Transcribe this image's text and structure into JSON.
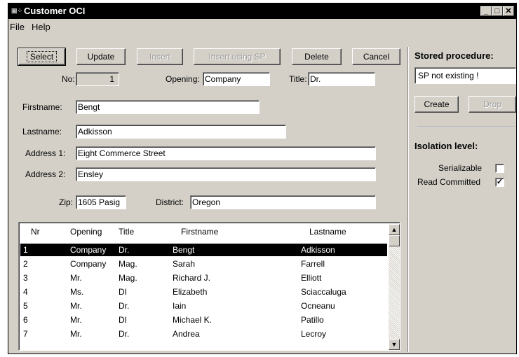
{
  "window": {
    "title": "Customer OCI",
    "icon": "window-app-icon"
  },
  "menu": [
    {
      "label": "File"
    },
    {
      "label": "Help"
    }
  ],
  "toolbar": {
    "select": "Select",
    "update": "Update",
    "insert": "Insert",
    "insert_sp": "Insert using SP",
    "delete": "Delete",
    "cancel": "Cancel"
  },
  "form": {
    "no_label": "No:",
    "no_value": "1",
    "opening_label": "Opening:",
    "opening_value": "Company",
    "title_label": "Title:",
    "title_value": "Dr.",
    "firstname_label": "Firstname:",
    "firstname_value": "Bengt",
    "lastname_label": "Lastname:",
    "lastname_value": "Adkisson",
    "address1_label": "Address 1:",
    "address1_value": "Eight Commerce Street",
    "address2_label": "Address 2:",
    "address2_value": "Ensley",
    "zip_label": "Zip:",
    "zip_value": "1605 Pasig",
    "district_label": "District:",
    "district_value": "Oregon"
  },
  "table": {
    "headers": [
      "Nr",
      "Opening",
      "Title",
      "Firstname",
      "Lastname"
    ],
    "rows": [
      [
        "1",
        "Company",
        "Dr.",
        "Bengt",
        "Adkisson"
      ],
      [
        "2",
        "Company",
        "Mag.",
        "Sarah",
        "Farrell"
      ],
      [
        "3",
        "Mr.",
        "Mag.",
        "Richard J.",
        "Elliott"
      ],
      [
        "4",
        "Ms.",
        "DI",
        "Elizabeth",
        "Sciaccaluga"
      ],
      [
        "5",
        "Mr.",
        "Dr.",
        "Iain",
        "Ocneanu"
      ],
      [
        "6",
        "Mr.",
        "DI",
        "Michael K.",
        "Patillo"
      ],
      [
        "7",
        "Mr.",
        "Dr.",
        "Andrea",
        "Lecroy"
      ]
    ],
    "selected_row": 0
  },
  "side": {
    "sp_title": "Stored procedure:",
    "sp_status": "SP not existing !",
    "create": "Create",
    "drop": "Drop",
    "iso_title": "Isolation level:",
    "serializable": "Serializable",
    "serializable_checked": false,
    "read_committed": "Read Committed",
    "read_committed_checked": true
  }
}
